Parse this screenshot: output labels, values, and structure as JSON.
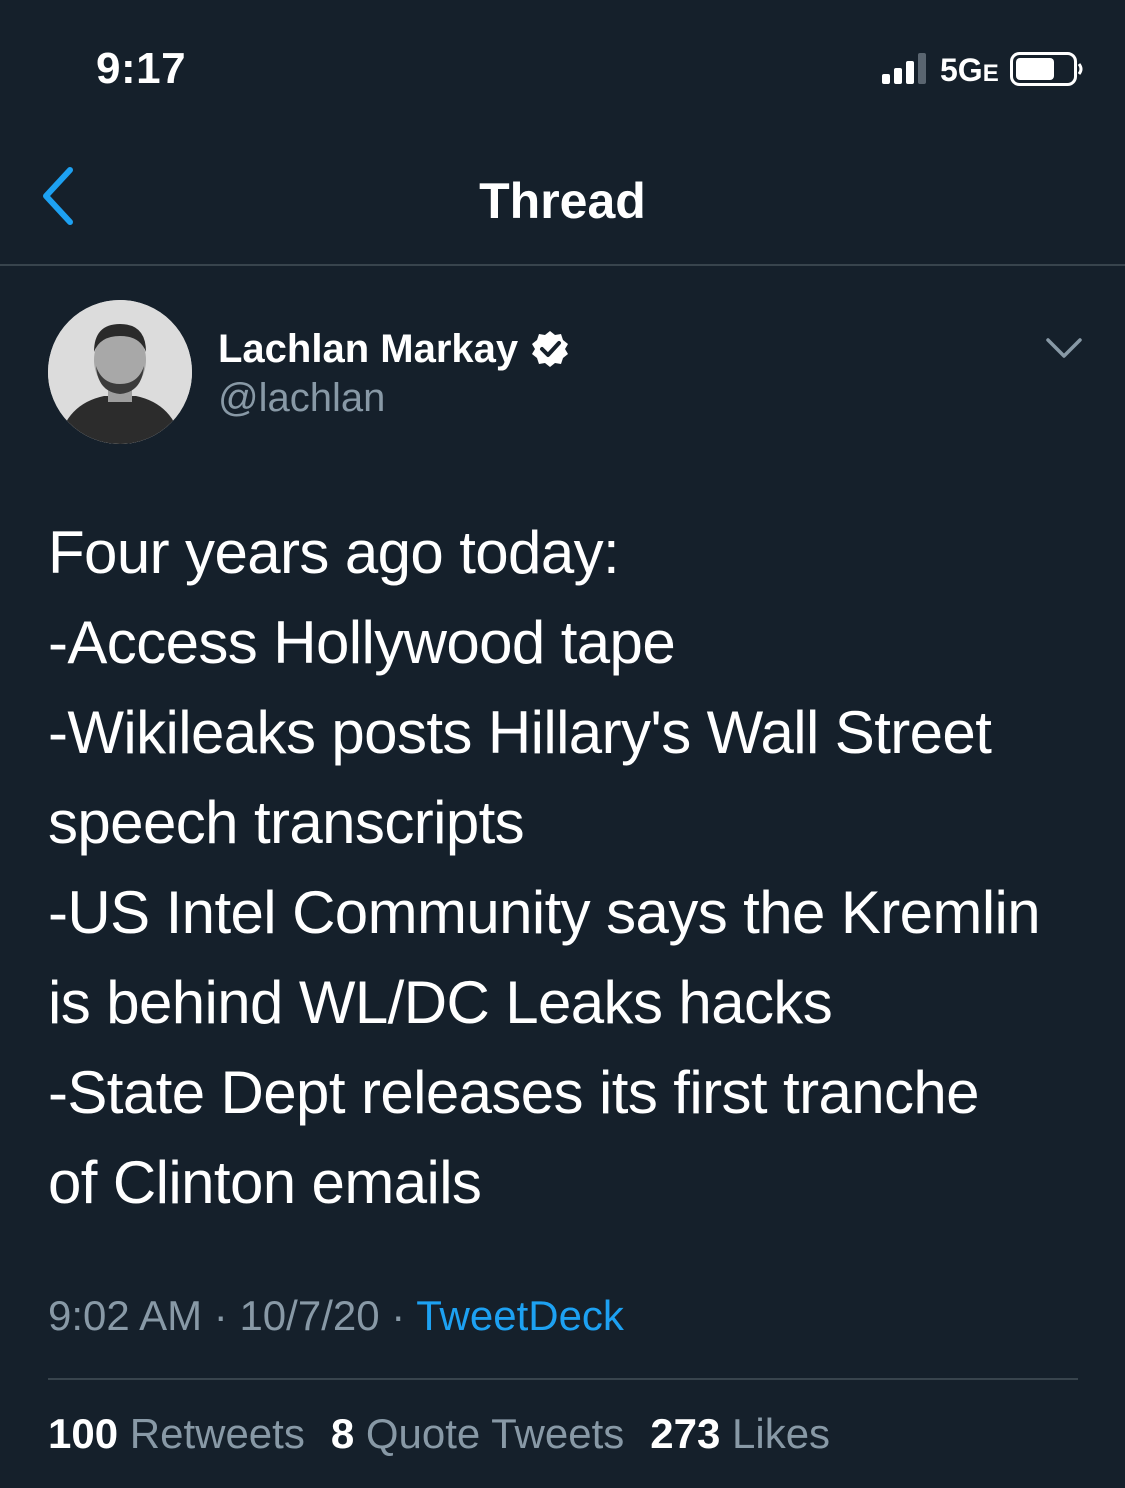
{
  "status_bar": {
    "time": "9:17",
    "network": "5G",
    "network_suffix": "E"
  },
  "header": {
    "title": "Thread",
    "back_icon": "chevron-left-icon"
  },
  "tweet": {
    "author": {
      "name": "Lachlan Markay",
      "handle": "@lachlan",
      "verified": true
    },
    "lines": [
      "Four years ago today:",
      "-Access Hollywood tape",
      "-Wikileaks posts Hillary's Wall Street",
      "speech transcripts",
      "-US Intel Community says the Kremlin",
      "is behind WL/DC Leaks hacks",
      "-State Dept releases its first tranche",
      "of Clinton emails"
    ],
    "time": "9:02 AM",
    "separator": "·",
    "date": "10/7/20",
    "source": "TweetDeck"
  },
  "stats": {
    "retweets_count": "100",
    "retweets_label": "Retweets",
    "quotes_count": "8",
    "quotes_label": "Quote Tweets",
    "likes_count": "273",
    "likes_label": "Likes"
  },
  "colors": {
    "background": "#15202b",
    "accent": "#1da1f2",
    "secondary_text": "#8899a6",
    "divider": "#38444d"
  }
}
